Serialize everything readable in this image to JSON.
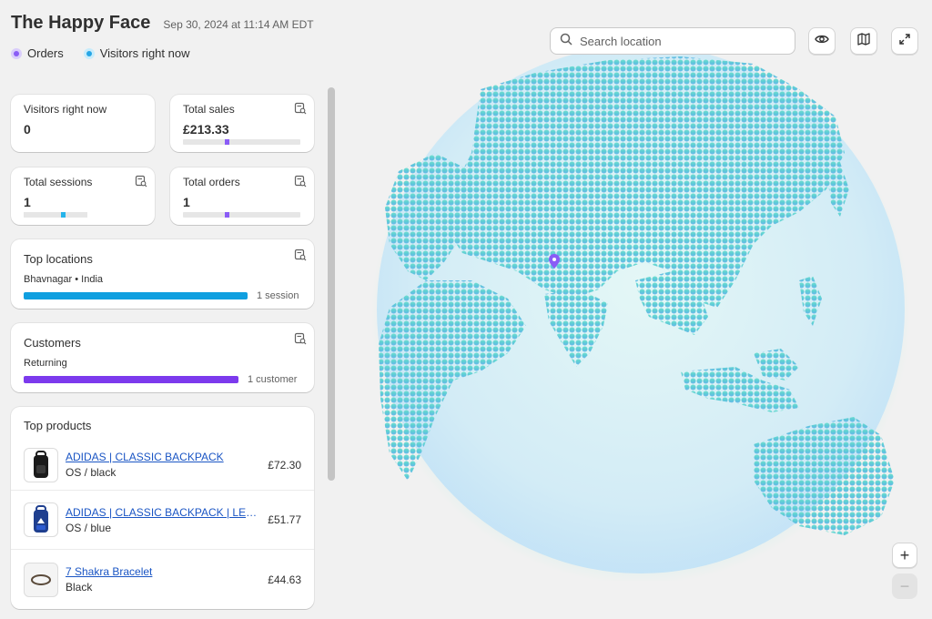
{
  "header": {
    "store_name": "The Happy Face",
    "timestamp": "Sep 30, 2024 at 11:14 AM EDT"
  },
  "legend": {
    "orders_label": "Orders",
    "visitors_label": "Visitors right now",
    "orders_color": "#8a5cf6",
    "visitors_color": "#26a6e6"
  },
  "metrics": {
    "visitors": {
      "label": "Visitors right now",
      "value": "0"
    },
    "sales": {
      "label": "Total sales",
      "value": "£213.33"
    },
    "sessions": {
      "label": "Total sessions",
      "value": "1"
    },
    "orders": {
      "label": "Total orders",
      "value": "1"
    }
  },
  "top_locations": {
    "title": "Top locations",
    "location": "Bhavnagar • India",
    "count_text": "1 session",
    "bar_color": "#0f9fe0"
  },
  "customers": {
    "title": "Customers",
    "segment": "Returning",
    "count_text": "1 customer",
    "bar_color": "#7c3aed"
  },
  "top_products": {
    "title": "Top products",
    "items": [
      {
        "name": "ADIDAS | CLASSIC BACKPACK",
        "variant": "OS / black",
        "price": "£72.30"
      },
      {
        "name": "ADIDAS | CLASSIC BACKPACK | LEGEND INK MULTICOLOUR",
        "variant": "OS / blue",
        "price": "£51.77"
      },
      {
        "name": "7 Shakra Bracelet",
        "variant": "Black",
        "price": "£44.63"
      }
    ]
  },
  "map": {
    "search_placeholder": "Search location",
    "zoom_in": "+",
    "zoom_out": "−",
    "pin_color": "#8a5cf6"
  },
  "icons": {
    "visibility": "eye-icon",
    "map_view": "map-icon",
    "fullscreen": "expand-icon",
    "search": "search-icon",
    "report": "report-icon"
  }
}
